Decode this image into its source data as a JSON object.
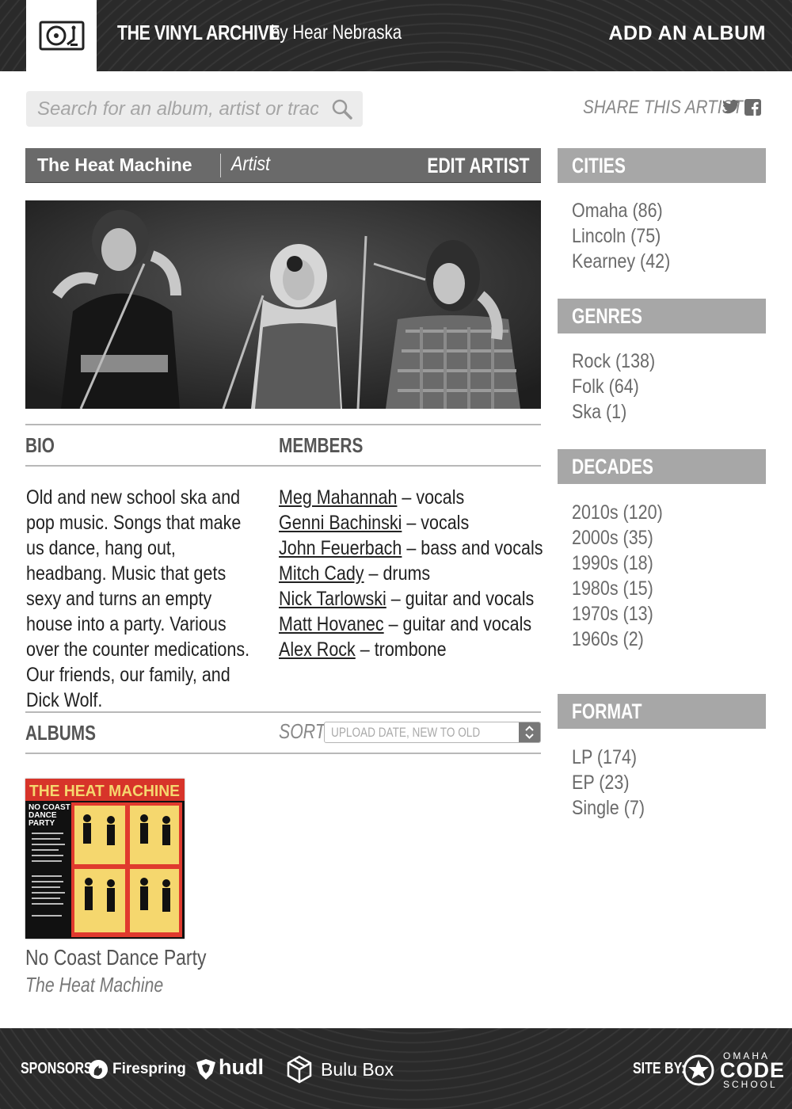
{
  "header": {
    "site_title": "THE VINYL ARCHIVE",
    "site_subtitle": "by Hear Nebraska",
    "add_album": "ADD AN ALBUM"
  },
  "search": {
    "placeholder": "Search for an album, artist or track..."
  },
  "share": {
    "label": "SHARE THIS ARTIST"
  },
  "artist": {
    "name": "The Heat Machine",
    "role": "Artist",
    "edit_label": "EDIT ARTIST"
  },
  "bio": {
    "heading": "BIO",
    "text": "Old and new school ska and pop music. Songs that make us dance, hang out, headbang. Music that gets sexy and turns an empty house into a party. Various over the counter medications. Our friends, our family, and Dick Wolf."
  },
  "members": {
    "heading": "MEMBERS",
    "items": [
      {
        "name": "Meg Mahannah",
        "role": "vocals"
      },
      {
        "name": "Genni Bachinski",
        "role": "vocals"
      },
      {
        "name": "John Feuerbach",
        "role": "bass and vocals"
      },
      {
        "name": "Mitch Cady",
        "role": "drums"
      },
      {
        "name": "Nick Tarlowski",
        "role": "guitar and vocals"
      },
      {
        "name": "Matt Hovanec",
        "role": "guitar and vocals"
      },
      {
        "name": "Alex Rock",
        "role": "trombone"
      }
    ],
    "separator": " – "
  },
  "albums": {
    "heading": "ALBUMS",
    "sort_label": "SORT",
    "sort_value": "UPLOAD DATE, NEW TO OLD",
    "items": [
      {
        "cover_band": "THE HEAT MACHINE",
        "cover_title_1": "NO COAST",
        "cover_title_2": "DANCE",
        "cover_title_3": "PARTY",
        "title": "No Coast Dance Party",
        "artist": "The Heat Machine"
      }
    ]
  },
  "sidebar": {
    "cities": {
      "heading": "CITIES",
      "items": [
        "Omaha (86)",
        "Lincoln (75)",
        "Kearney (42)"
      ]
    },
    "genres": {
      "heading": "GENRES",
      "items": [
        "Rock (138)",
        "Folk (64)",
        "Ska (1)"
      ]
    },
    "decades": {
      "heading": "DECADES",
      "items": [
        "2010s (120)",
        "2000s (35)",
        "1990s (18)",
        "1980s (15)",
        "1970s (13)",
        "1960s (2)"
      ]
    },
    "format": {
      "heading": "FORMAT",
      "items": [
        "LP (174)",
        "EP (23)",
        "Single (7)"
      ]
    }
  },
  "footer": {
    "sponsors_label": "SPONSORS:",
    "sponsors": [
      "Firespring",
      "hudl",
      "Bulu Box"
    ],
    "site_by_label": "SITE BY:",
    "site_by_small_top": "OMAHA",
    "site_by_big": "CODE",
    "site_by_small_bottom": "SCHOOL"
  },
  "colors": {
    "header_bg": "#2c2c2c",
    "artist_bar": "#6a6a6a",
    "sidebar_head": "#a7a7a7",
    "album_red": "#e03a2e",
    "album_yellow": "#f5d76e"
  }
}
